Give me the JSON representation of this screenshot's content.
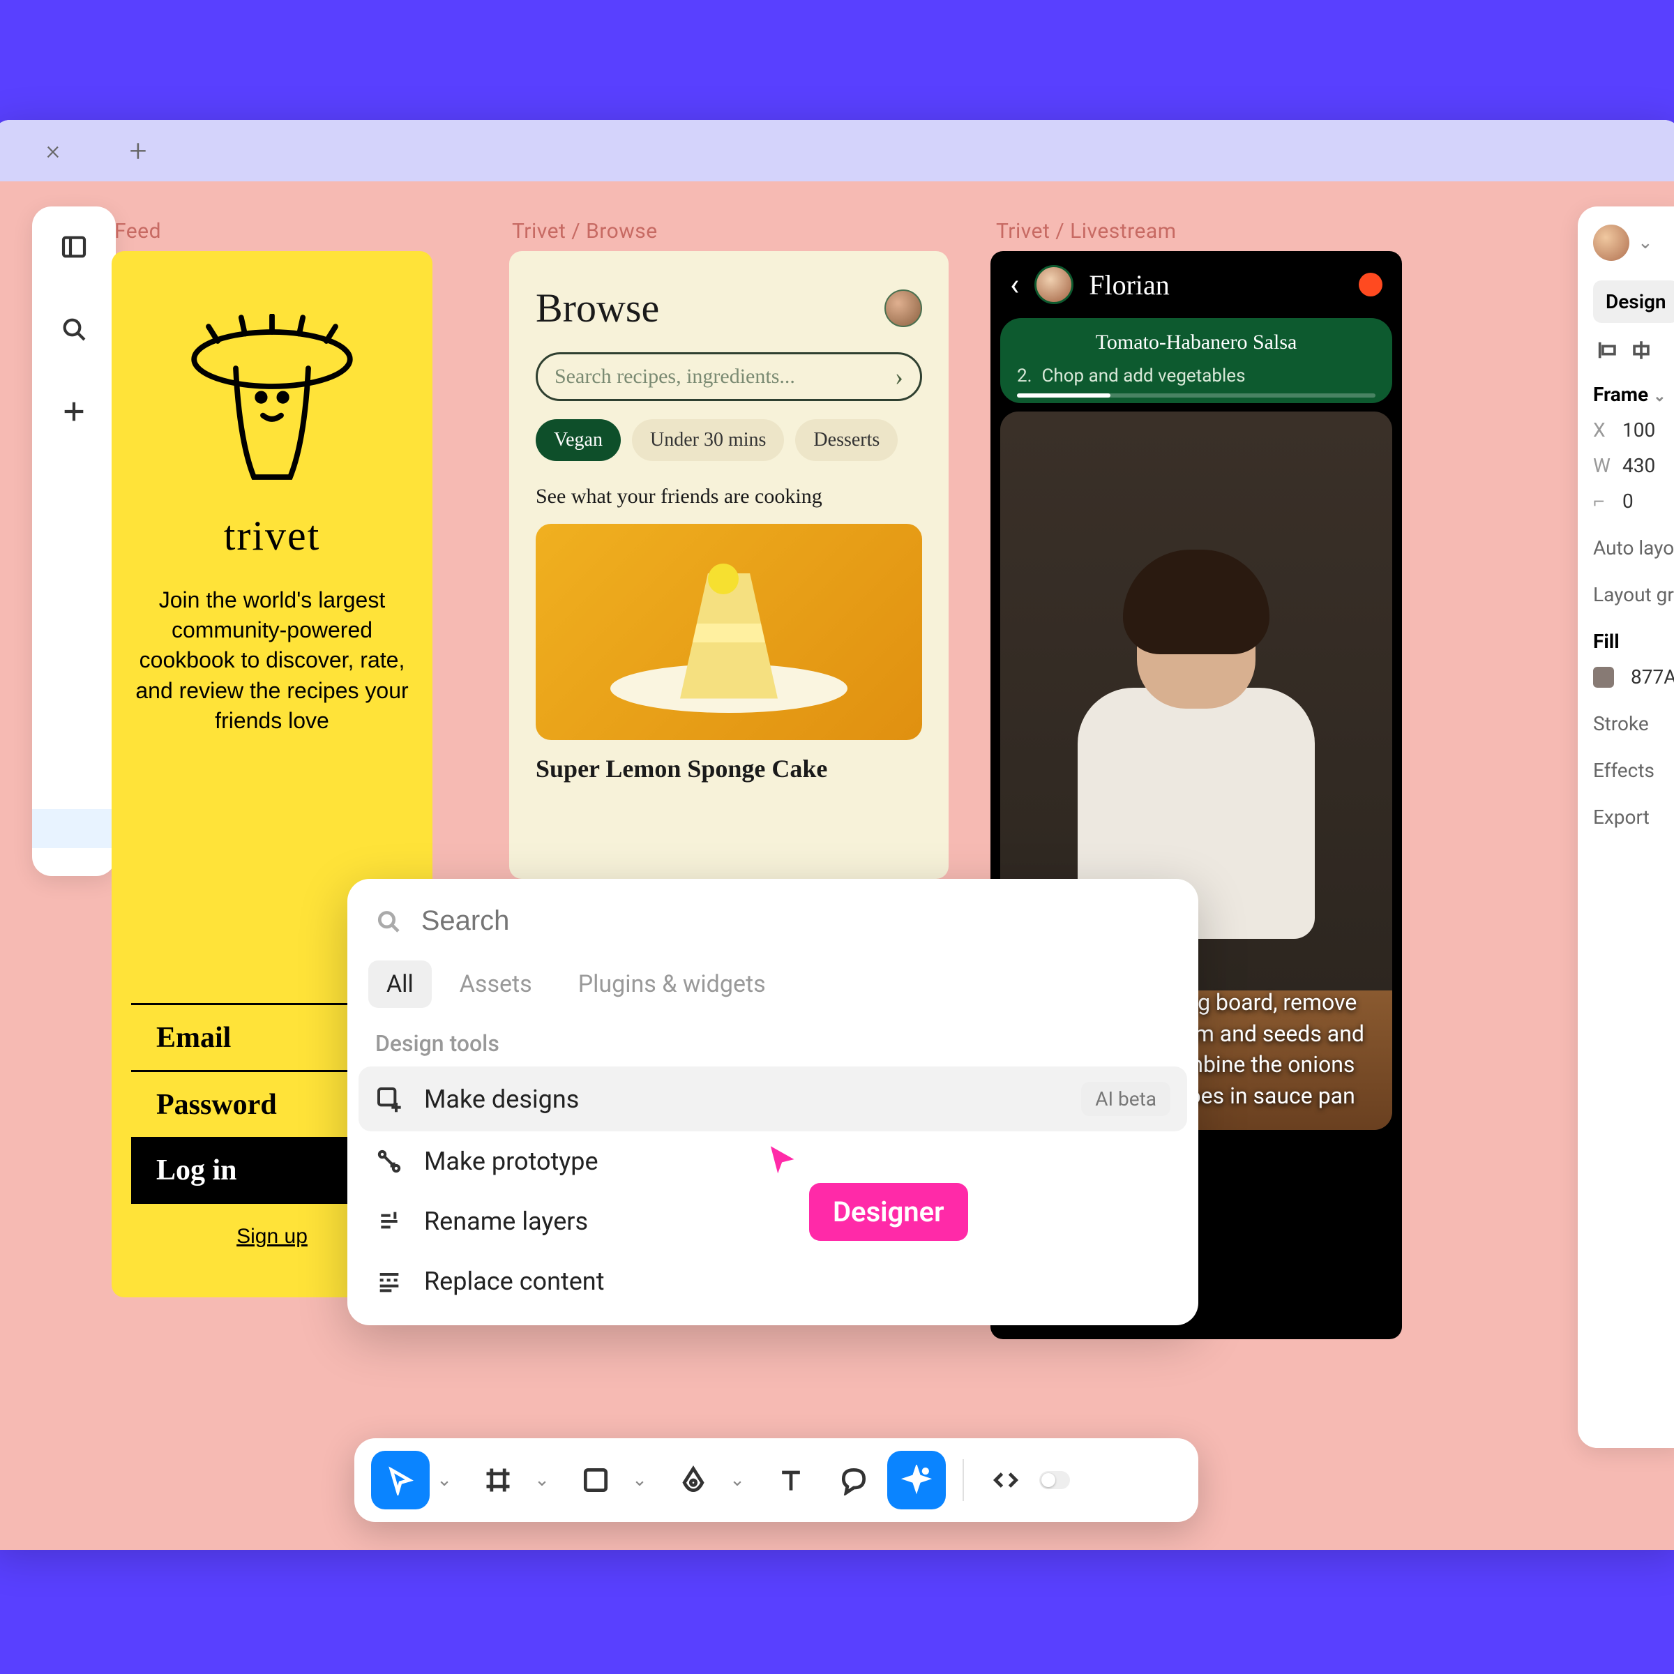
{
  "frames": {
    "feed": "Feed",
    "browse": "Trivet / Browse",
    "livestream": "Trivet / Livestream"
  },
  "login": {
    "brand": "trivet",
    "blurb": "Join the world's largest community-powered cookbook to discover, rate, and review the recipes your friends love",
    "email": "Email",
    "password": "Password",
    "login": "Log in",
    "signup": "Sign up"
  },
  "browse": {
    "title": "Browse",
    "search_placeholder": "Search recipes, ingredients...",
    "pills": [
      "Vegan",
      "Under 30 mins",
      "Desserts"
    ],
    "subhdr": "See what your friends are cooking",
    "card_title": "Super Lemon Sponge Cake"
  },
  "live": {
    "name": "Florian",
    "recipe": "Tomato-Habanero Salsa",
    "step_num": "2.",
    "step_text": "Chop and add vegetables",
    "caption": "On a large cutting board, remove the habanero stem and seeds and finely chop. Combine the onions then add tomatoes in sauce pan"
  },
  "palette": {
    "search_placeholder": "Search",
    "tabs": [
      "All",
      "Assets",
      "Plugins & widgets"
    ],
    "section": "Design tools",
    "items": [
      {
        "label": "Make designs",
        "badge": "AI beta"
      },
      {
        "label": "Make prototype"
      },
      {
        "label": "Rename layers"
      },
      {
        "label": "Replace content"
      }
    ]
  },
  "cursor_label": "Designer",
  "props": {
    "tab": "Design",
    "frame": "Frame",
    "x_label": "X",
    "x_val": "100",
    "w_label": "W",
    "w_val": "430",
    "r_label": "⌐",
    "r_val": "0",
    "auto_layout": "Auto layo",
    "layout_grid": "Layout gr",
    "fill": "Fill",
    "fill_val": "877A",
    "stroke": "Stroke",
    "effects": "Effects",
    "export": "Export"
  }
}
